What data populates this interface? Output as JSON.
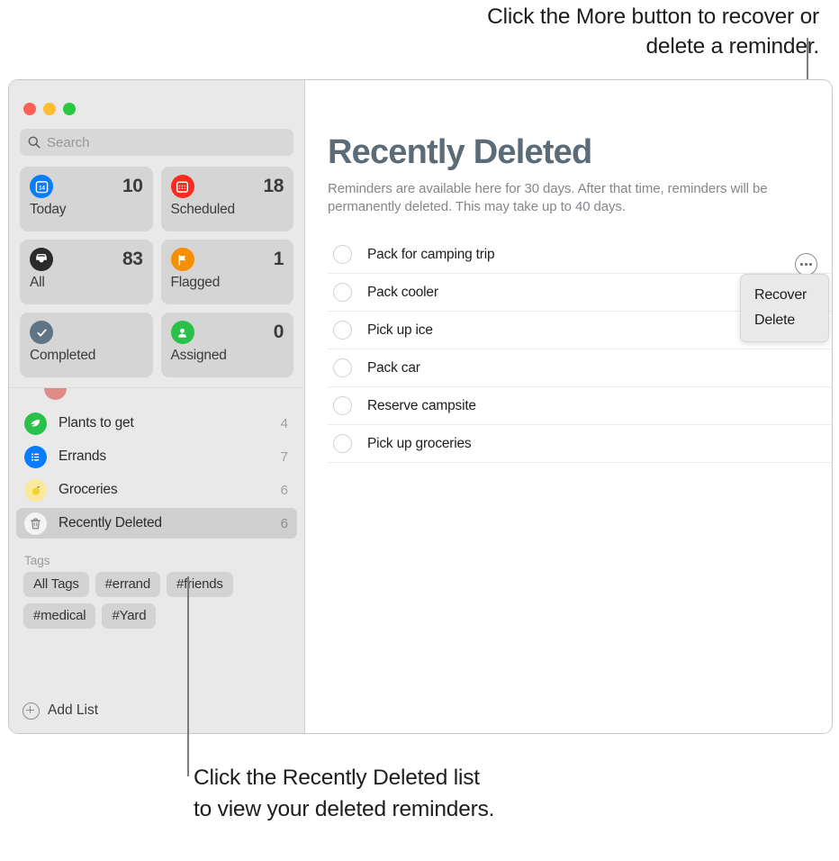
{
  "annotations": {
    "top": "Click the More button to recover or delete a reminder.",
    "bottom": "Click the Recently Deleted list to view your deleted reminders."
  },
  "window": {
    "traffic_lights": [
      {
        "name": "close",
        "color": "#ff5f57"
      },
      {
        "name": "minimize",
        "color": "#febc2e"
      },
      {
        "name": "zoom",
        "color": "#28c840"
      }
    ]
  },
  "sidebar": {
    "search": {
      "placeholder": "Search",
      "value": "",
      "icon": "search-icon"
    },
    "quick_access": [
      {
        "id": "today",
        "label": "Today",
        "count": "10",
        "icon": "calendar-day-icon",
        "color": "#0a7cff"
      },
      {
        "id": "scheduled",
        "label": "Scheduled",
        "count": "18",
        "icon": "calendar-icon",
        "color": "#fb2b20"
      },
      {
        "id": "all",
        "label": "All",
        "count": "83",
        "icon": "inbox-icon",
        "color": "#2b2b2d"
      },
      {
        "id": "flagged",
        "label": "Flagged",
        "count": "1",
        "icon": "flag-icon",
        "color": "#f59000"
      },
      {
        "id": "completed",
        "label": "Completed",
        "count": "",
        "icon": "checkmark-icon",
        "color": "#5f7585"
      },
      {
        "id": "assigned",
        "label": "Assigned",
        "count": "0",
        "icon": "person-icon",
        "color": "#2ac14a"
      }
    ],
    "lists": [
      {
        "label": "Plants to get",
        "count": "4",
        "icon": "leaf-icon",
        "color": "#2ac14a",
        "selected": false
      },
      {
        "label": "Errands",
        "count": "7",
        "icon": "list-bullet-icon",
        "color": "#0a7cff",
        "selected": false
      },
      {
        "label": "Groceries",
        "count": "6",
        "icon": "lemon-icon",
        "color": "#fbe89a",
        "selected": false
      },
      {
        "label": "Recently Deleted",
        "count": "6",
        "icon": "trash-icon",
        "color": "#f2f2f2",
        "selected": true
      }
    ],
    "tags": {
      "title": "Tags",
      "items": [
        "All Tags",
        "#errand",
        "#friends",
        "#medical",
        "#Yard"
      ]
    },
    "add_list": {
      "label": "Add List",
      "icon": "plus-circle-icon"
    }
  },
  "main": {
    "title": "Recently Deleted",
    "subtitle": "Reminders are available here for 30 days. After that time, reminders will be permanently deleted. This may take up to 40 days.",
    "reminders": [
      {
        "title": "Pack for camping trip",
        "completed": false
      },
      {
        "title": "Pack cooler",
        "completed": false
      },
      {
        "title": "Pick up ice",
        "completed": false
      },
      {
        "title": "Pack car",
        "completed": false
      },
      {
        "title": "Reserve campsite",
        "completed": false
      },
      {
        "title": "Pick up groceries",
        "completed": false
      }
    ],
    "more_button": {
      "icon": "ellipsis-circle-icon"
    },
    "context_menu": {
      "items": [
        "Recover",
        "Delete"
      ]
    }
  }
}
